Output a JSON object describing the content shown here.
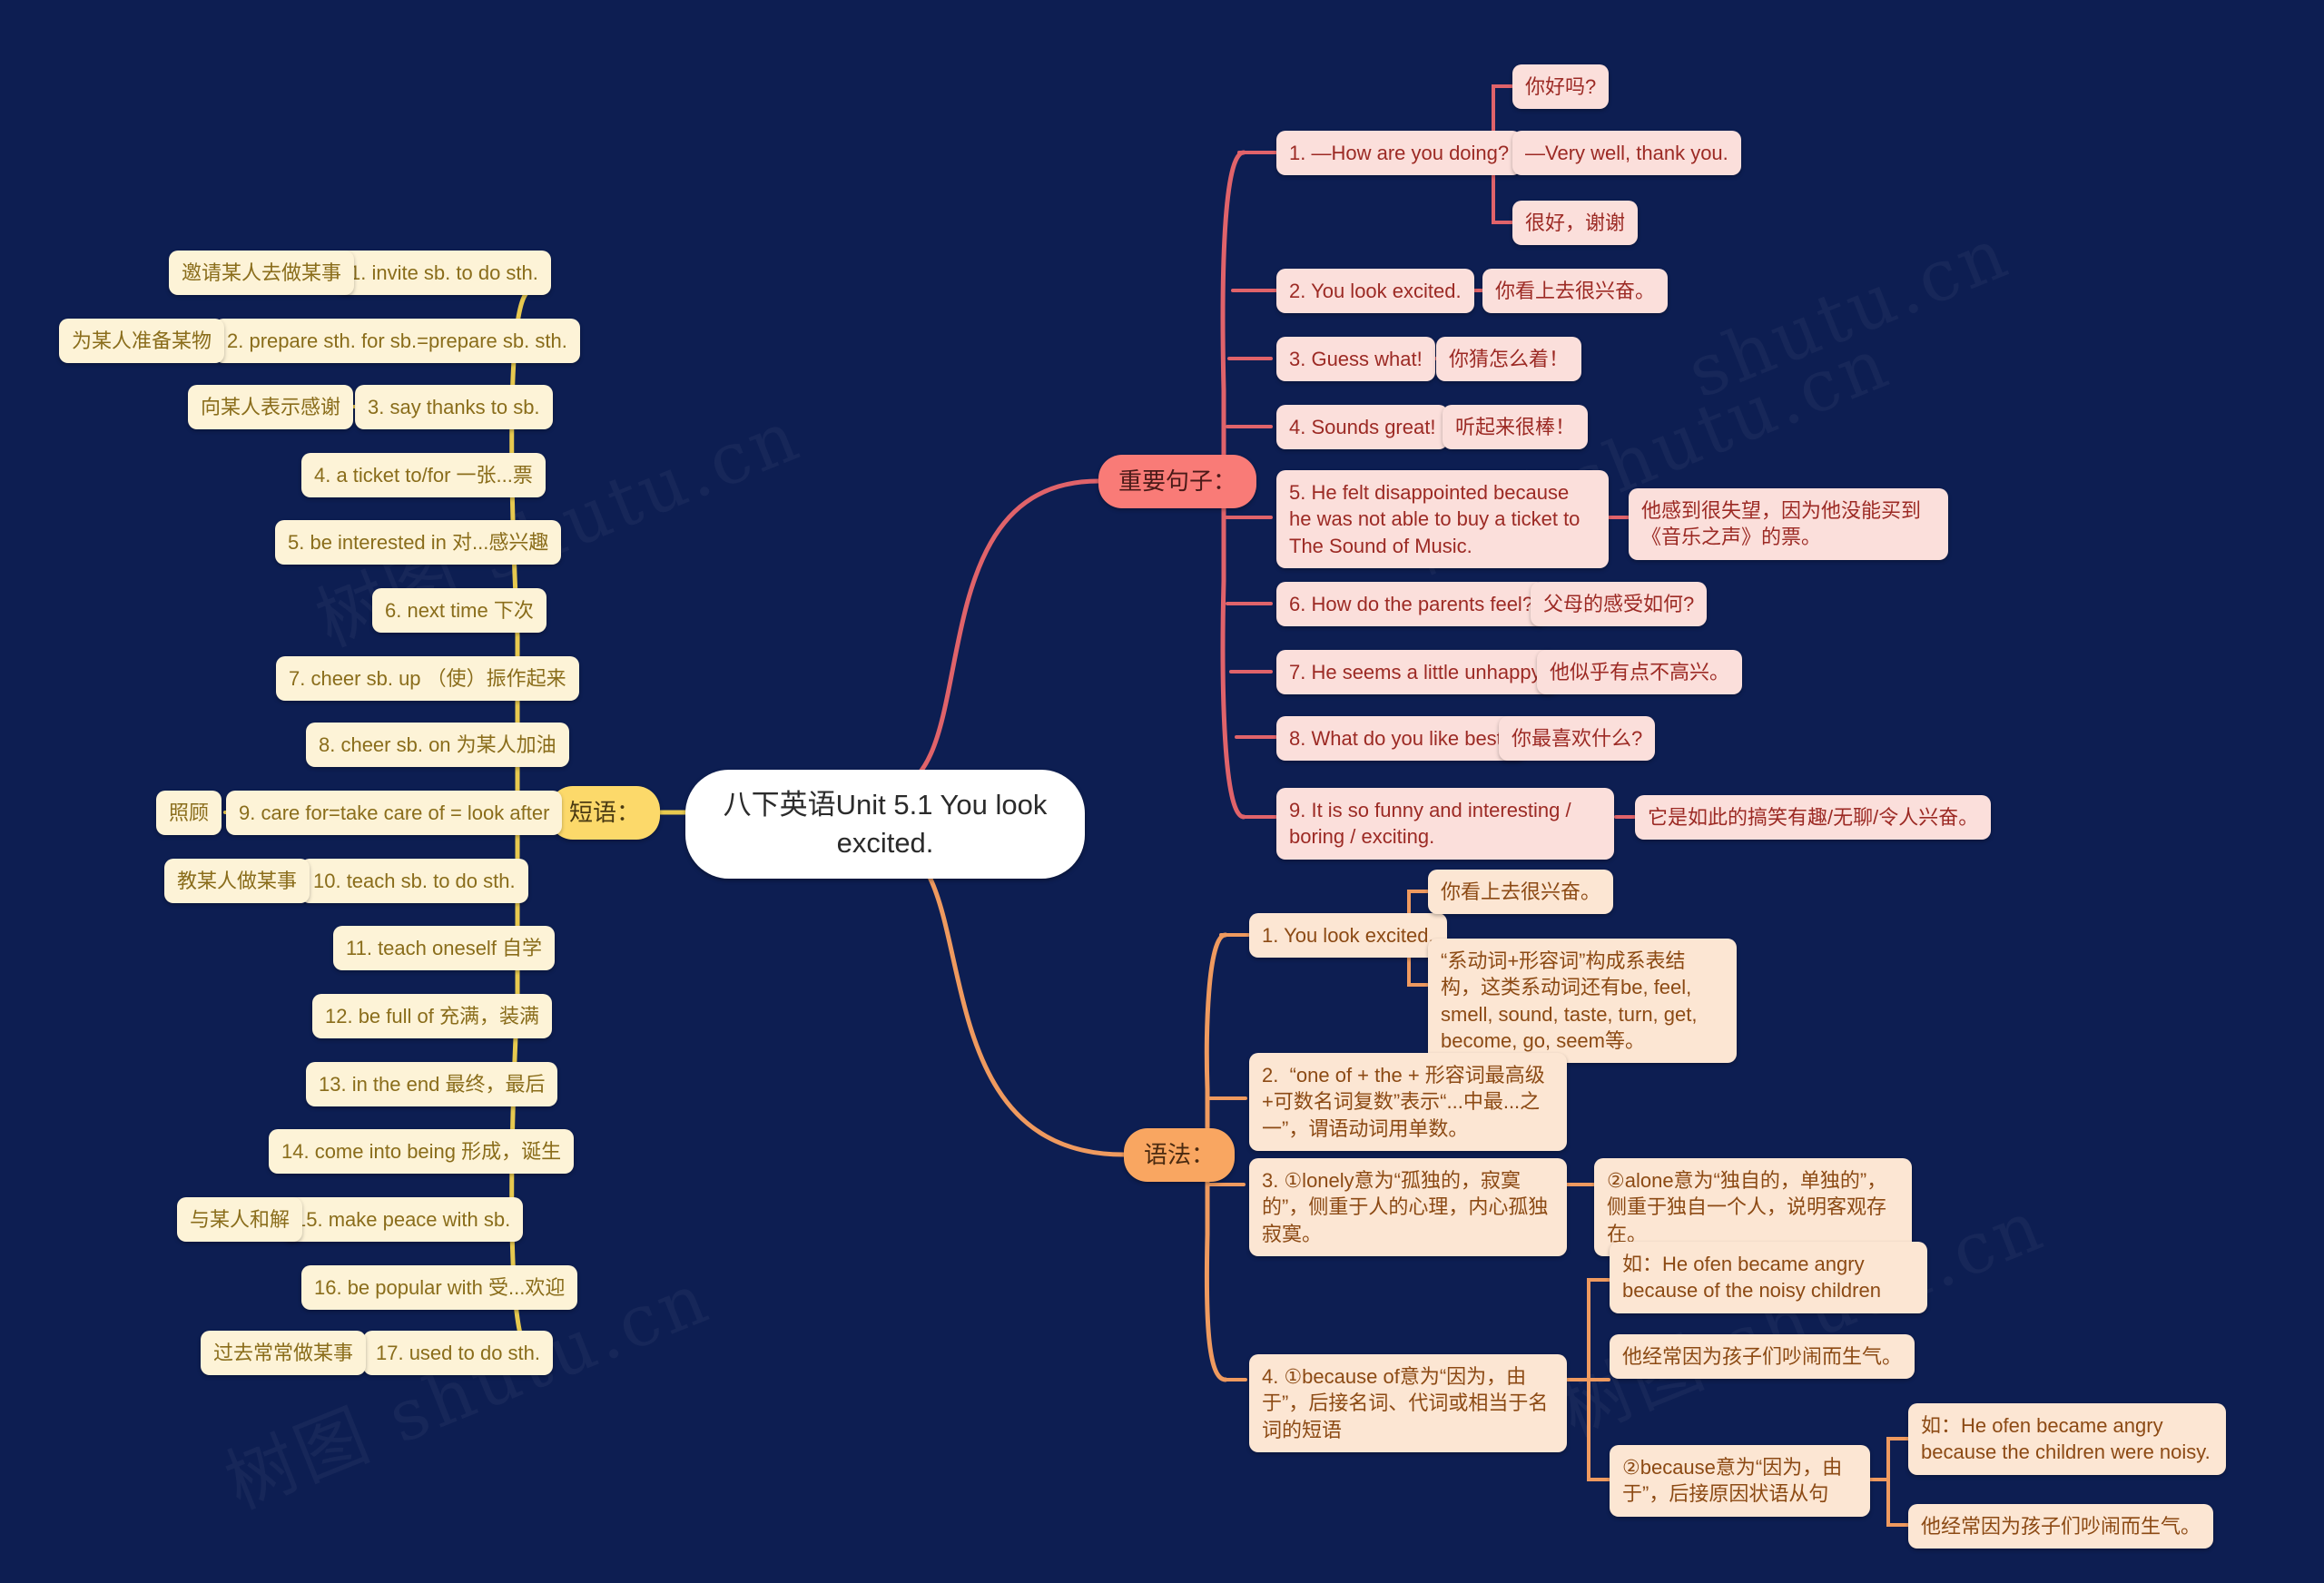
{
  "meta": {
    "background_color": "#0d1e52",
    "watermark_text": "树图 shutu.cn"
  },
  "root": {
    "title": "八下英语Unit 5.1 You look excited."
  },
  "branches": [
    {
      "key": "phrases",
      "label": "短语：",
      "color": "#fcd96a",
      "node_fill": "#fdf3d7",
      "node_text": "#8a6d1b"
    },
    {
      "key": "sentences",
      "label": "重要句子：",
      "color": "#f97b77",
      "node_fill": "#fbdfdb",
      "node_text": "#9c2a24"
    },
    {
      "key": "grammar",
      "label": "语法：",
      "color": "#f9a661",
      "node_fill": "#fce6d3",
      "node_text": "#8c4a14"
    }
  ],
  "phrases": {
    "items": [
      {
        "en": "1. invite sb. to do sth.",
        "zh": "邀请某人去做某事"
      },
      {
        "en": "2. prepare sth. for sb.=prepare sb. sth.",
        "zh": "为某人准备某物"
      },
      {
        "en": "3. say thanks to sb.",
        "zh": "向某人表示感谢"
      },
      {
        "en": "4. a ticket to/for  一张...票",
        "zh": ""
      },
      {
        "en": "5. be interested in  对...感兴趣",
        "zh": ""
      },
      {
        "en": "6. next time 下次",
        "zh": ""
      },
      {
        "en": "7. cheer sb. up （使）振作起来",
        "zh": ""
      },
      {
        "en": "8. cheer sb. on 为某人加油",
        "zh": ""
      },
      {
        "en": "9. care for=take care of = look after",
        "zh": "照顾"
      },
      {
        "en": "10. teach sb. to do sth.",
        "zh": "教某人做某事"
      },
      {
        "en": "11. teach oneself  自学",
        "zh": ""
      },
      {
        "en": "12. be full of  充满，装满",
        "zh": ""
      },
      {
        "en": "13. in the end  最终，最后",
        "zh": ""
      },
      {
        "en": "14. come into being 形成，诞生",
        "zh": ""
      },
      {
        "en": "15. make peace with sb.",
        "zh": "与某人和解"
      },
      {
        "en": "16. be popular with 受...欢迎",
        "zh": ""
      },
      {
        "en": "17. used to do sth.",
        "zh": "过去常常做某事"
      }
    ]
  },
  "sentences": {
    "items": [
      {
        "en": "1. —How are you doing?",
        "children": [
          "你好吗?",
          "—Very well, thank you.",
          "很好，谢谢"
        ]
      },
      {
        "en": "2. You look excited.",
        "children": [
          "你看上去很兴奋。"
        ]
      },
      {
        "en": "3. Guess what!",
        "children": [
          "你猜怎么着！"
        ]
      },
      {
        "en": "4. Sounds great!",
        "children": [
          "听起来很棒！"
        ]
      },
      {
        "en": "5. He felt disappointed because he was not able to buy a ticket to The Sound of Music.",
        "children": [
          "他感到很失望，因为他没能买到《音乐之声》的票。"
        ]
      },
      {
        "en": "6. How do the parents feel?",
        "children": [
          "父母的感受如何?"
        ]
      },
      {
        "en": "7. He seems a little unhappy.",
        "children": [
          "他似乎有点不高兴。"
        ]
      },
      {
        "en": "8. What do you like best?",
        "children": [
          "你最喜欢什么?"
        ]
      },
      {
        "en": "9. It is so funny and interesting / boring / exciting.",
        "children": [
          "它是如此的搞笑有趣/无聊/令人兴奋。"
        ]
      }
    ]
  },
  "grammar": {
    "item1": {
      "text": "1. You look excited.",
      "children": [
        "你看上去很兴奋。",
        "“系动词+形容词”构成系表结构，这类系动词还有be, feel, smell, sound, taste, turn, get, become, go, seem等。"
      ]
    },
    "item2": {
      "text": "2.  “one of + the + 形容词最高级+可数名词复数”表示“...中最...之一”，谓语动词用单数。"
    },
    "item3": {
      "text": "3. ①lonely意为“孤独的，寂寞的”，侧重于人的心理，内心孤独寂寞。",
      "children": [
        "②alone意为“独自的，单独的”，侧重于独自一个人，说明客观存在。"
      ]
    },
    "item4": {
      "text": "4. ①because of意为“因为，由于”，后接名词、代词或相当于名词的短语",
      "children": [
        {
          "text": "如：He ofen became angry because of the noisy children",
          "children": []
        },
        {
          "text": "他经常因为孩子们吵闹而生气。",
          "children": []
        },
        {
          "text": "②because意为“因为，由于”，后接原因状语从句",
          "children": [
            "如：He ofen became angry because the children were noisy.",
            "他经常因为孩子们吵闹而生气。"
          ]
        }
      ]
    }
  }
}
